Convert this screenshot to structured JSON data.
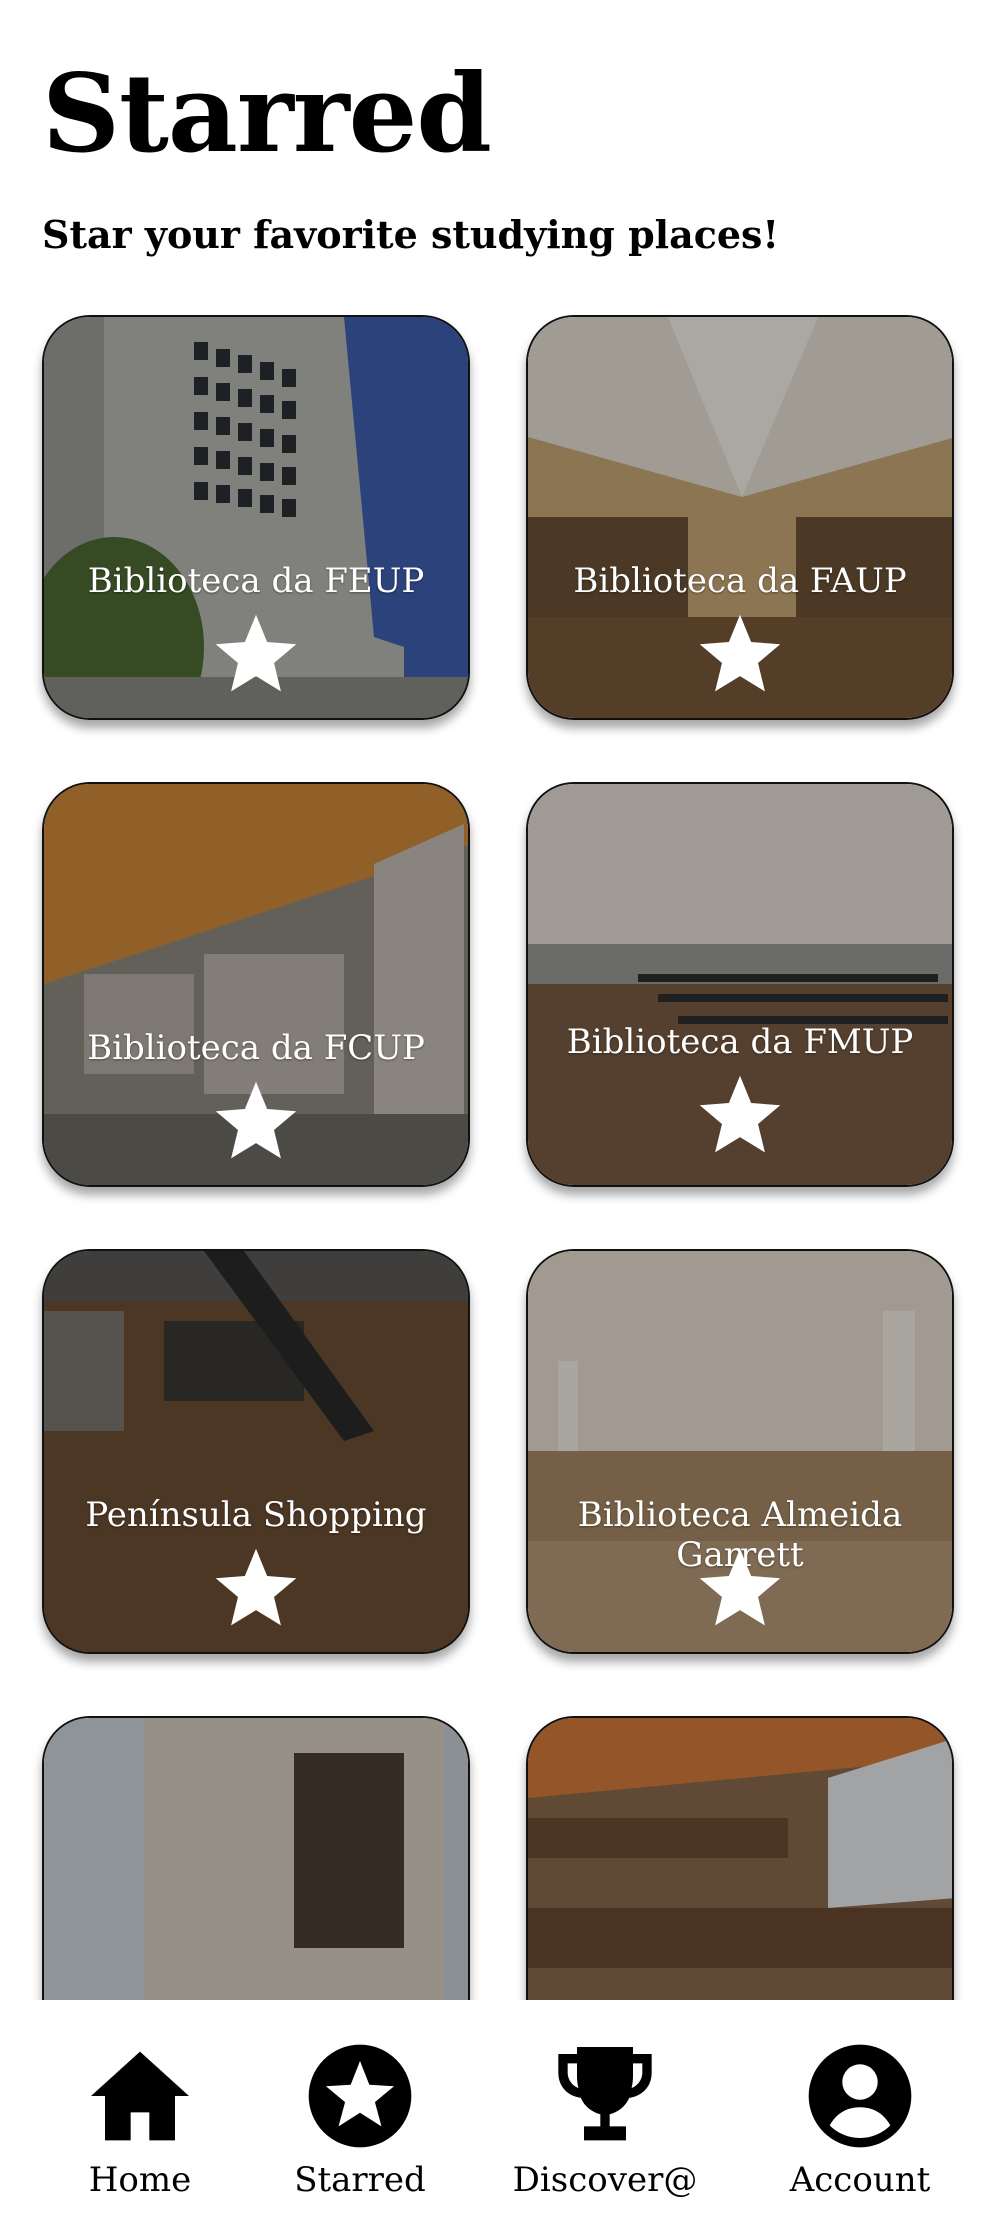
{
  "header": {
    "title": "Starred",
    "subtitle": "Star your favorite studying places!"
  },
  "places": [
    {
      "name": "Biblioteca da FEUP",
      "starred": true
    },
    {
      "name": "Biblioteca da FAUP",
      "starred": true
    },
    {
      "name": "Biblioteca da FCUP",
      "starred": true
    },
    {
      "name": "Biblioteca da FMUP",
      "starred": true
    },
    {
      "name": "Península Shopping",
      "starred": true
    },
    {
      "name": "Biblioteca Almeida Garrett",
      "starred": true
    },
    {
      "name": "",
      "starred": true
    },
    {
      "name": "",
      "starred": true
    }
  ],
  "bottom_nav": {
    "items": [
      {
        "label": "Home",
        "icon": "home-icon"
      },
      {
        "label": "Starred",
        "icon": "star-circle-icon"
      },
      {
        "label": "Discover@",
        "icon": "trophy-icon"
      },
      {
        "label": "Account",
        "icon": "account-icon"
      }
    ]
  },
  "colors": {
    "background": "#ffffff",
    "card_border": "#111111",
    "star": "#ffffff",
    "nav_icon": "#000000"
  }
}
